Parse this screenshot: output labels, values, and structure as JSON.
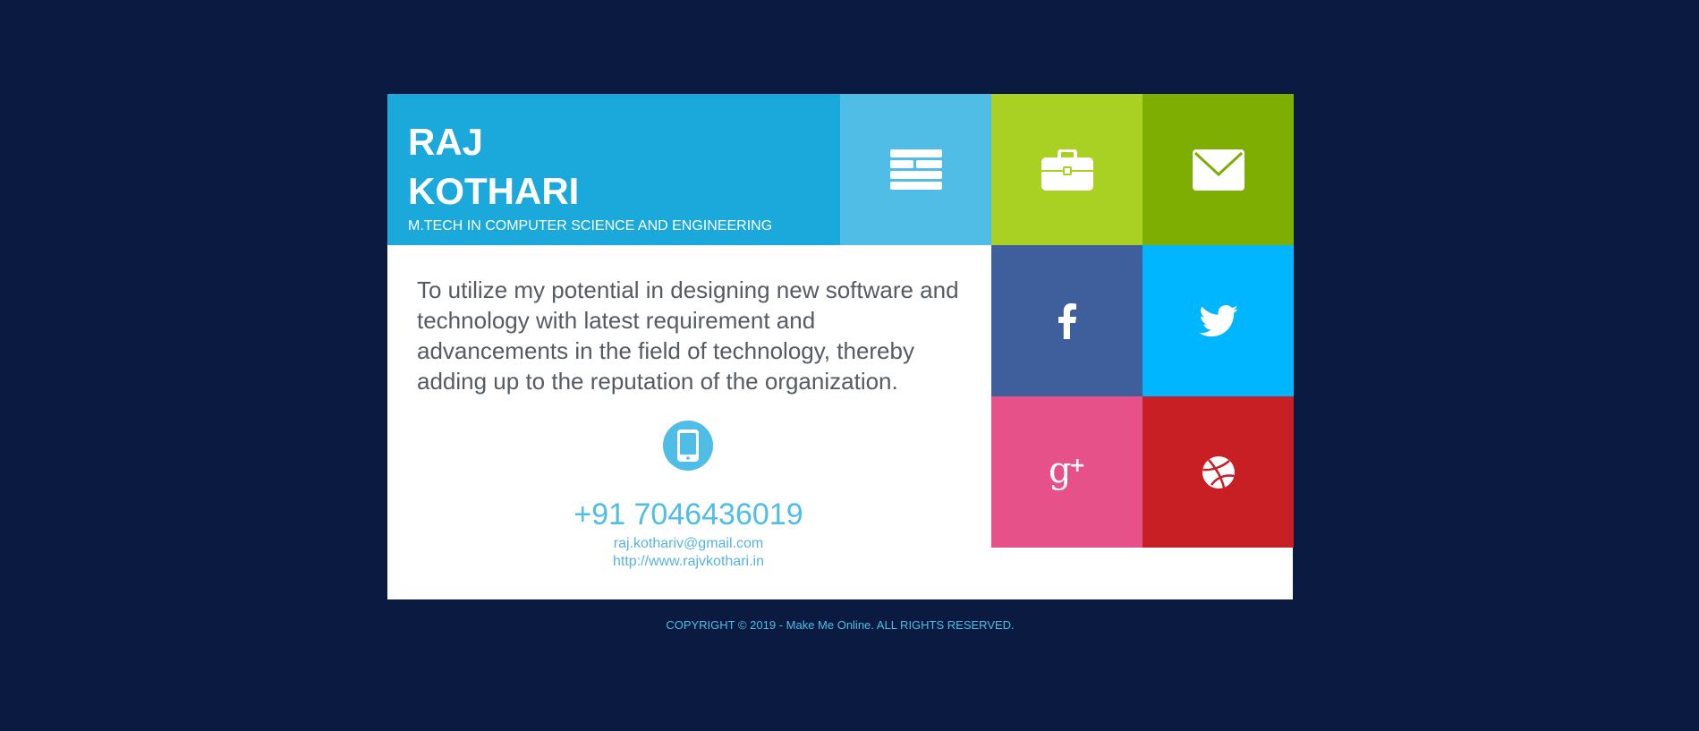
{
  "profile": {
    "first_name": "RAJ",
    "last_name": "KOTHARI",
    "degree": "M.TECH IN COMPUTER SCIENCE AND ENGINEERING"
  },
  "tiles": [
    {
      "icon": "menu-icon",
      "color": "#50bde6"
    },
    {
      "icon": "briefcase-icon",
      "color": "#a9d124"
    },
    {
      "icon": "mail-icon",
      "color": "#7eae01"
    },
    {
      "icon": "facebook-icon",
      "color": "#3e5e9c"
    },
    {
      "icon": "twitter-icon",
      "color": "#00b7ff"
    },
    {
      "icon": "google-plus-icon",
      "color": "#e6518a"
    },
    {
      "icon": "dribbble-icon",
      "color": "#c71f24"
    }
  ],
  "objective": "To utilize my potential in designing new software and technology with latest requirement and advancements in the field of technology, thereby adding up to the reputation of the organization.",
  "contact": {
    "phone_icon": "mobile-phone-icon",
    "phone": "+91 7046436019",
    "email": "raj.kothariv@gmail.com",
    "website": "http://www.rajvkothari.in"
  },
  "footer": {
    "copyright": "COPYRIGHT © 2019 - Make Me Online. ALL RIGHTS RESERVED."
  },
  "colors": {
    "background": "#0a1a40",
    "accent": "#1ba8da",
    "light_blue": "#50bde6"
  }
}
